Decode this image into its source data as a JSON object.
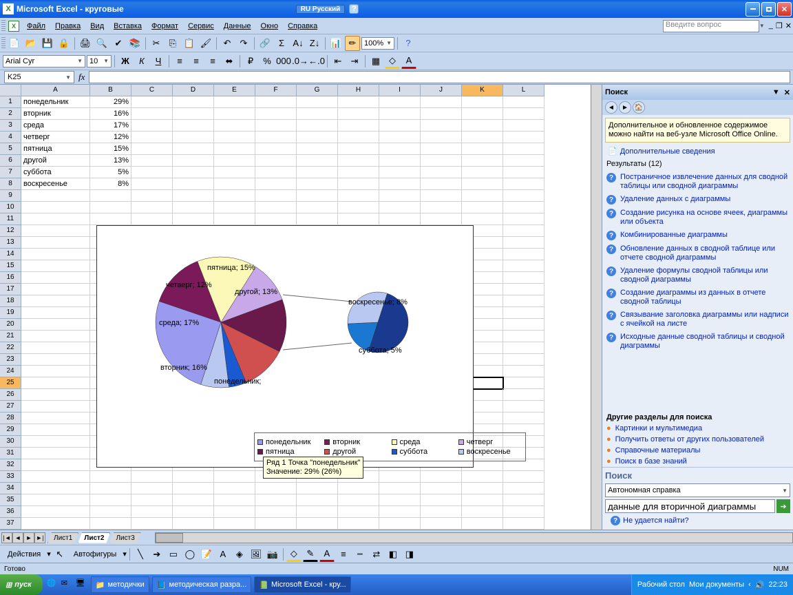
{
  "window": {
    "title": "Microsoft Excel - круговые",
    "lang_indicator": "RU Русский"
  },
  "menu": {
    "items": [
      "Файл",
      "Правка",
      "Вид",
      "Вставка",
      "Формат",
      "Сервис",
      "Данные",
      "Окно",
      "Справка"
    ],
    "ask": "Введите вопрос"
  },
  "toolbar": {
    "zoom": "100%"
  },
  "formatting": {
    "font": "Arial Cyr",
    "size": "10"
  },
  "namebox": "K25",
  "sheet": {
    "cols": [
      "A",
      "B",
      "C",
      "D",
      "E",
      "F",
      "G",
      "H",
      "I",
      "J",
      "K",
      "L"
    ],
    "rows": [
      {
        "day": "понедельник",
        "val": "29%"
      },
      {
        "day": "вторник",
        "val": "16%"
      },
      {
        "day": "среда",
        "val": "17%"
      },
      {
        "day": "четверг",
        "val": "12%"
      },
      {
        "day": "пятница",
        "val": "15%"
      },
      {
        "day": "другой",
        "val": "13%"
      },
      {
        "day": "суббота",
        "val": "5%"
      },
      {
        "day": "воскресенье",
        "val": "8%"
      }
    ],
    "active_row": 25,
    "sel_col": "K",
    "tabs": [
      "Лист1",
      "Лист2",
      "Лист3"
    ],
    "active_tab": "Лист2"
  },
  "chart_data": {
    "type": "pie",
    "categories": [
      "понедельник",
      "вторник",
      "среда",
      "четверг",
      "пятница",
      "другой",
      "суббота",
      "воскресенье"
    ],
    "values": [
      29,
      16,
      17,
      12,
      15,
      13,
      5,
      8
    ],
    "colors": [
      "#9a9af0",
      "#7a1a5a",
      "#fcf8b8",
      "#c8a8e8",
      "#6a1a4a",
      "#d05050",
      "#1a5ad0",
      "#b8c8f0"
    ],
    "labels": [
      "понедельник;",
      "вторник; 16%",
      "среда; 17%",
      "четверг; 12%",
      "пятница; 15%",
      "другой; 13%",
      "суббота; 5%",
      "воскресенье; 8%"
    ],
    "subpie": {
      "categories": [
        "суббота",
        "воскресенье",
        "другой"
      ],
      "values": [
        5,
        8,
        13
      ],
      "colors": [
        "#1a78d0",
        "#b8c8f0",
        "#1a3a90"
      ]
    },
    "tooltip": {
      "line1": "Ряд 1 Точка \"понедельник\"",
      "line2": "Значение: 29% (26%)"
    }
  },
  "taskpane": {
    "title": "Поиск",
    "info": "Дополнительное и обновленное содержимое можно найти на веб-узле Microsoft Office Online.",
    "info_link": "Дополнительные сведения",
    "results_header": "Результаты (12)",
    "results": [
      "Постраничное извлечение данных для сводной таблицы или сводной диаграммы",
      "Удаление данных с диаграммы",
      "Создание рисунка на основе ячеек, диаграммы или объекта",
      "Комбинированные диаграммы",
      "Обновление данных в сводной таблице или отчете сводной диаграммы",
      "Удаление формулы сводной таблицы или сводной диаграммы",
      "Создание диаграммы из данных в отчете сводной таблицы",
      "Связывание заголовка диаграммы или надписи с ячейкой на листе",
      "Исходные данные сводной таблицы и сводной диаграммы"
    ],
    "other_header": "Другие разделы для поиска",
    "other": [
      "Картинки и мультимедиа",
      "Получить ответы от других пользователей",
      "Справочные материалы",
      "Поиск в базе знаний"
    ],
    "search_section": "Поиск",
    "search_scope": "Автономная справка",
    "search_query": "данные для вторичной диаграммы",
    "cant_find": "Не удается найти?"
  },
  "drawing": {
    "actions": "Действия",
    "autoshapes": "Автофигуры"
  },
  "status": {
    "ready": "Готово",
    "num": "NUM"
  },
  "taskbar": {
    "start": "пуск",
    "items": [
      "методички",
      "методическая разра...",
      "Microsoft Excel - кру..."
    ],
    "desktop": "Рабочий стол",
    "docs": "Мои документы",
    "time": "22:23"
  }
}
